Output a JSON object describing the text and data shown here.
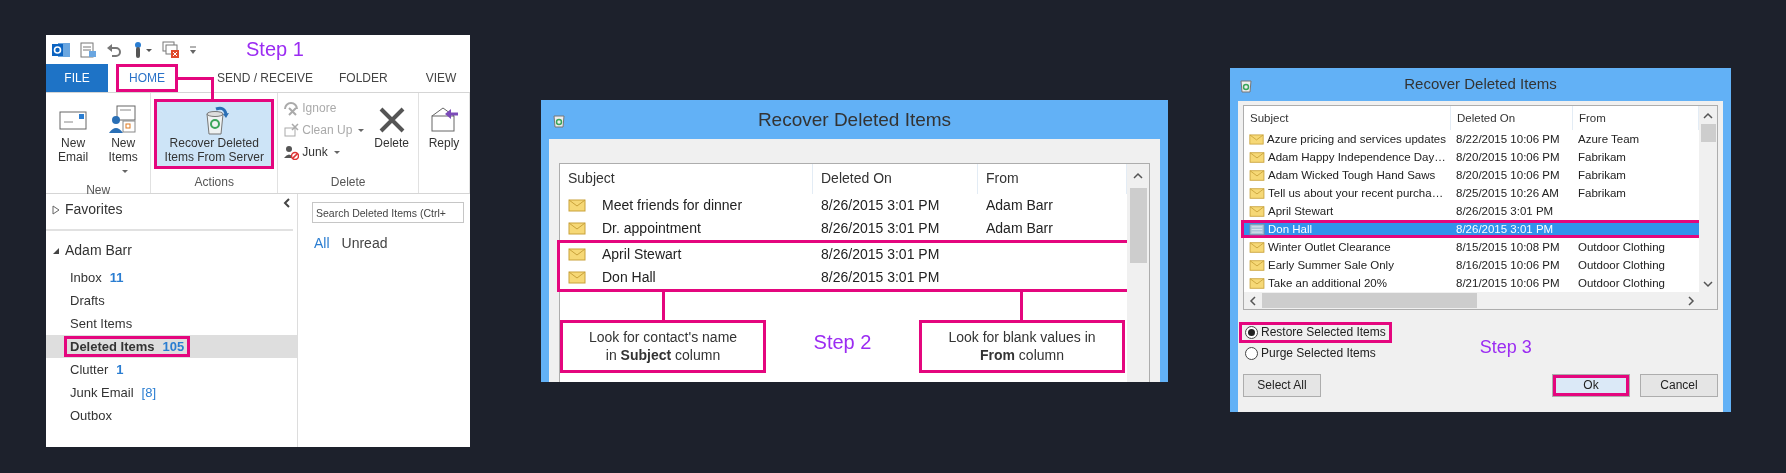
{
  "outlook": {
    "step_label": "Step 1",
    "tabs": [
      {
        "label": "FILE",
        "kind": "file",
        "selected": false,
        "highlighted": false
      },
      {
        "label": "HOME",
        "kind": "tab",
        "selected": true,
        "highlighted": true
      },
      {
        "label": "SEND / RECEIVE",
        "kind": "tab",
        "selected": false,
        "highlighted": false
      },
      {
        "label": "FOLDER",
        "kind": "tab",
        "selected": false,
        "highlighted": false
      },
      {
        "label": "VIEW",
        "kind": "tab",
        "selected": false,
        "highlighted": false
      }
    ],
    "ribbon_groups": [
      {
        "label": "New",
        "buttons": [
          {
            "label": "New Email",
            "kind": "large",
            "dropdown": false,
            "disabled": false,
            "pressed": false,
            "highlighted": false
          },
          {
            "label": "New Items",
            "kind": "large",
            "dropdown": true,
            "disabled": false,
            "pressed": false,
            "highlighted": false
          }
        ]
      },
      {
        "label": "Actions",
        "buttons": [
          {
            "label": "Recover Deleted Items From Server",
            "kind": "large",
            "dropdown": false,
            "disabled": false,
            "pressed": true,
            "highlighted": true
          }
        ]
      },
      {
        "label": "Delete",
        "buttons": [
          {
            "label": "Ignore",
            "kind": "small",
            "dropdown": false,
            "disabled": true,
            "pressed": false,
            "highlighted": false
          },
          {
            "label": "Clean Up",
            "kind": "small",
            "dropdown": true,
            "disabled": true,
            "pressed": false,
            "highlighted": false
          },
          {
            "label": "Junk",
            "kind": "small",
            "dropdown": true,
            "disabled": false,
            "pressed": false,
            "highlighted": false
          },
          {
            "label": "Delete",
            "kind": "large",
            "dropdown": false,
            "disabled": false,
            "pressed": false,
            "highlighted": false
          }
        ]
      },
      {
        "buttons": [
          {
            "label": "Reply",
            "kind": "large",
            "dropdown": false,
            "disabled": false,
            "pressed": false,
            "highlighted": false
          }
        ]
      }
    ],
    "favorites": {
      "label": "Favorites",
      "expanded": false
    },
    "account": {
      "label": "Adam Barr",
      "expanded": true
    },
    "folders": [
      {
        "name": "Inbox",
        "count": "11",
        "selected": false,
        "highlighted": false
      },
      {
        "name": "Drafts",
        "selected": false,
        "highlighted": false
      },
      {
        "name": "Sent Items",
        "selected": false,
        "highlighted": false
      },
      {
        "name": "Deleted Items",
        "count": "105",
        "selected": true,
        "highlighted": true
      },
      {
        "name": "Clutter",
        "count": "1",
        "selected": false,
        "highlighted": false
      },
      {
        "name": "Junk Email",
        "count": "[8]",
        "selected": false,
        "highlighted": false
      },
      {
        "name": "Outbox",
        "selected": false,
        "highlighted": false
      }
    ],
    "search": {
      "placeholder": "Search Deleted Items (Ctrl+"
    },
    "filters": [
      {
        "label": "All",
        "selected": true
      },
      {
        "label": "Unread",
        "selected": false
      }
    ]
  },
  "dialog_step2": {
    "title": "Recover Deleted Items",
    "columns": [
      "Subject",
      "Deleted On",
      "From"
    ],
    "rows": [
      {
        "subject": "Meet friends for dinner",
        "deleted_on": "8/26/2015 3:01 PM",
        "from": "Adam Barr",
        "highlighted": false
      },
      {
        "subject": "Dr. appointment",
        "deleted_on": "8/26/2015 3:01 PM",
        "from": "Adam Barr",
        "highlighted": false
      },
      {
        "subject": "April Stewart",
        "deleted_on": "8/26/2015 3:01 PM",
        "highlighted": true
      },
      {
        "subject": "Don Hall",
        "deleted_on": "8/26/2015 3:01 PM",
        "highlighted": true
      }
    ],
    "callouts": [
      {
        "text": "Look for contact's name in **Subject** column"
      },
      {
        "text": "Look for blank values in **From** column"
      }
    ],
    "step_label": "Step 2"
  },
  "dialog_step3": {
    "title": "Recover Deleted Items",
    "columns": [
      "Subject",
      "Deleted On",
      "From"
    ],
    "rows": [
      {
        "subject": "Azure pricing and services updates",
        "deleted_on": "8/22/2015 10:06 PM",
        "from": "Azure Team",
        "selected": false,
        "highlighted": false
      },
      {
        "subject": "Adam Happy Independence Day…",
        "deleted_on": "8/20/2015 10:06 PM",
        "from": "Fabrikam",
        "selected": false,
        "highlighted": false
      },
      {
        "subject": "Adam Wicked Tough  Hand Saws",
        "deleted_on": "8/20/2015 10:06 PM",
        "from": "Fabrikam",
        "selected": false,
        "highlighted": false
      },
      {
        "subject": "Tell us about your recent purcha…",
        "deleted_on": "8/25/2015 10:26 AM",
        "from": "Fabrikam",
        "selected": false,
        "highlighted": false
      },
      {
        "subject": "April Stewart",
        "deleted_on": "8/26/2015 3:01 PM",
        "selected": false,
        "highlighted": false
      },
      {
        "subject": "Don Hall",
        "deleted_on": "8/26/2015 3:01 PM",
        "selected": true,
        "highlighted": true
      },
      {
        "subject": "Winter Outlet Clearance",
        "deleted_on": "8/15/2015 10:08 PM",
        "from": "Outdoor Clothing",
        "selected": false,
        "highlighted": false
      },
      {
        "subject": "Early Summer Sale Only",
        "deleted_on": "8/16/2015 10:06 PM",
        "from": "Outdoor Clothing",
        "selected": false,
        "highlighted": false
      },
      {
        "subject": "Take an additional 20%",
        "deleted_on": "8/21/2015 10:06 PM",
        "from": "Outdoor Clothing",
        "selected": false,
        "highlighted": false
      }
    ],
    "options": [
      {
        "label": "Restore Selected Items",
        "selected": true,
        "highlighted": true
      },
      {
        "label": "Purge Selected Items",
        "selected": false,
        "highlighted": false
      }
    ],
    "step_label": "Step 3",
    "buttons": [
      {
        "label": "Select All",
        "highlighted": false
      },
      {
        "label": "Ok",
        "highlighted": true
      },
      {
        "label": "Cancel",
        "highlighted": false
      }
    ]
  }
}
